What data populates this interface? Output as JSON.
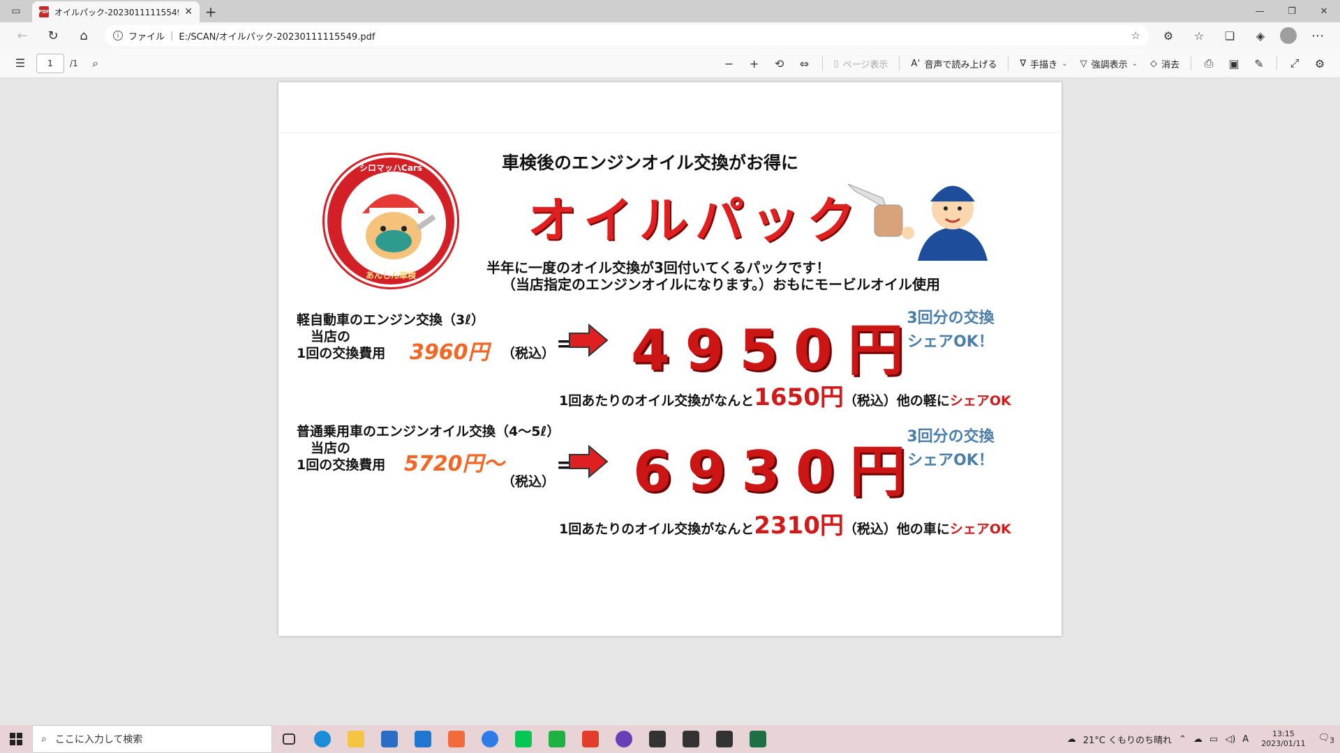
{
  "browser": {
    "tab_title": "オイルパック-20230111115549.pdf",
    "new_tab_label": "+",
    "address": {
      "scheme_label": "ファイル",
      "url": "E:/SCAN/オイルパック-20230111115549.pdf"
    }
  },
  "pdf_toolbar": {
    "page_current": "1",
    "page_total": "/1",
    "page_view_label": "ページ表示",
    "read_aloud_label": "音声で読み上げる",
    "draw_label": "手描き",
    "highlight_label": "強調表示",
    "erase_label": "消去"
  },
  "document": {
    "headline": "車検後のエンジンオイル交換がお得に",
    "brand_title": "オイルパック",
    "subline1": "半年に一度のオイル交換が3回付いてくるパックです！",
    "subline2": "（当店指定のエンジンオイルになります。）おもにモービルオイル使用",
    "logo_text_top": "シロマッハCars",
    "logo_text_bottom": "あんしん車検",
    "kei": {
      "label1": "軽自動車のエンジン交換（3ℓ）",
      "label2": "当店の",
      "label3": "1回の交換費用",
      "regular_price": "3960円",
      "tax": "（税込）",
      "equal": "=",
      "pack_price": "4950円",
      "share1": "3回分の交換",
      "share2": "シェアOK！",
      "per_prefix": "1回あたりのオイル交換がなんと",
      "per_price": "1650円",
      "per_suffix": "（税込）他の軽に",
      "per_share": "シェアOK"
    },
    "futsu": {
      "label1": "普通乗用車のエンジンオイル交換（4～5ℓ）",
      "label2": "当店の",
      "label3": "1回の交換費用",
      "regular_price": "5720円～",
      "tax": "（税込）",
      "equal": "=",
      "pack_price": "6930円",
      "share1": "3回分の交換",
      "share2": "シェアOK！",
      "per_prefix": "1回あたりのオイル交換がなんと",
      "per_price": "2310円",
      "per_suffix": "（税込）他の車に",
      "per_share": "シェアOK"
    }
  },
  "taskbar": {
    "search_placeholder": "ここに入力して検索",
    "weather": "21°C くもりのち晴れ",
    "time": "13:15",
    "date": "2023/01/11",
    "ime": "A",
    "notification_count": "3"
  }
}
